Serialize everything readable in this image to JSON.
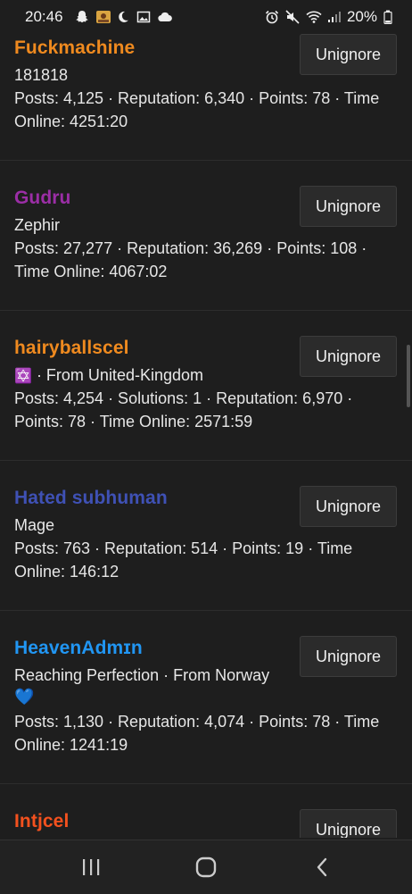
{
  "status_bar": {
    "time": "20:46",
    "battery": "20%",
    "icons_left": [
      "snapchat-icon",
      "photo-app-icon",
      "moon-icon",
      "gallery-icon",
      "cloud-icon"
    ],
    "icons_right": [
      "alarm-icon",
      "mute-icon",
      "wifi-icon",
      "signal-icon",
      "battery-icon"
    ]
  },
  "ignored_members": [
    {
      "username": "Fuckmachine",
      "color": "#ef8a1f",
      "title": "181818",
      "stats": "Posts: 4,125 · Reputation: 6,340 · Points: 78 · Time Online: 4251:20",
      "button": "Unignore"
    },
    {
      "username": "Gudru",
      "color": "#9b2ea6",
      "title": "Zephir",
      "stats": "Posts: 27,277 · Reputation: 36,269 · Points: 108 · Time Online: 4067:02",
      "button": "Unignore"
    },
    {
      "username": "hairyballscel",
      "color": "#ef8a1f",
      "title_emoji": "✡️",
      "title": "· From United-Kingdom",
      "stats": "Posts: 4,254 · Solutions: 1 · Reputation: 6,970 · Points: 78 · Time Online: 2571:59",
      "button": "Unignore"
    },
    {
      "username": "Hated subhuman",
      "color": "#3f51b5",
      "title": "Mage",
      "stats": "Posts: 763 · Reputation: 514 · Points: 19 · Time Online: 146:12",
      "button": "Unignore"
    },
    {
      "username": "HeavenAdmɪn",
      "color": "#2196f3",
      "title": "Reaching Perfection · From Norway",
      "title_emoji_line2": "💙",
      "stats": "Posts: 1,130 · Reputation: 4,074 · Points: 78 · Time Online: 1241:19",
      "button": "Unignore"
    },
    {
      "username": "Intjcel",
      "color": "#f4511e",
      "button": "Unignore"
    }
  ],
  "nav": {
    "recents": "recents-icon",
    "home": "home-icon",
    "back": "back-icon"
  }
}
